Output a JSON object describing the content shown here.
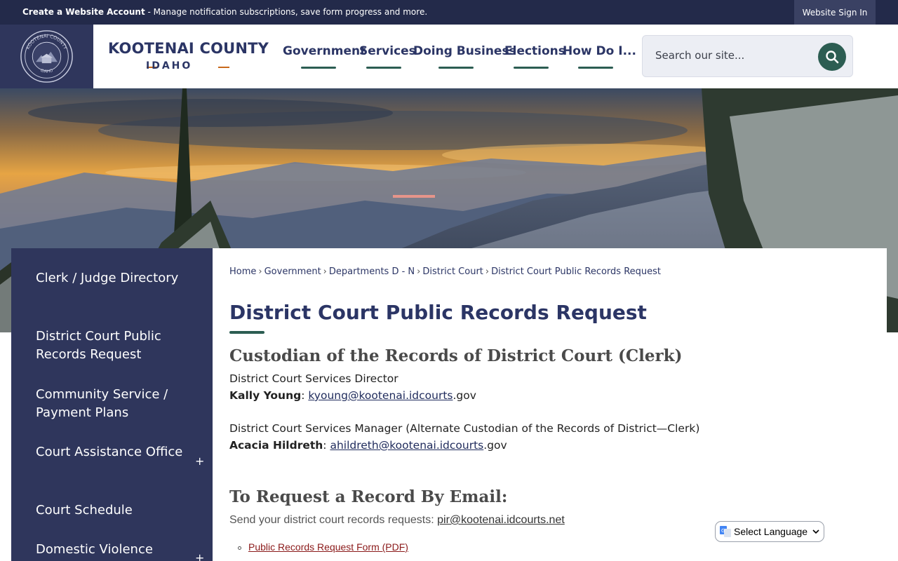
{
  "topbar": {
    "create_label": "Create a Website Account",
    "create_desc": " - Manage notification subscriptions, save form progress and more.",
    "signin_label": "Website Sign In"
  },
  "logo": {
    "title": "KOOTENAI COUNTY",
    "subtitle": "IDAHO",
    "seal_top_text": "KOOTENAI COUNTY",
    "seal_bottom_text": "IDAHO"
  },
  "nav": {
    "items": [
      {
        "label": "Government"
      },
      {
        "label": "Services"
      },
      {
        "label": "Doing Business"
      },
      {
        "label": "Elections"
      },
      {
        "label": "How Do I..."
      }
    ]
  },
  "search": {
    "placeholder": "Search our site..."
  },
  "sidebar": {
    "items": [
      {
        "label": "Clerk / Judge Directory",
        "expandable": false
      },
      {
        "label": "District Court Public Records Request",
        "expandable": false
      },
      {
        "label": "Community Service / Payment Plans",
        "expandable": false
      },
      {
        "label": "Court Assistance Office",
        "expandable": true
      },
      {
        "label": "Court Schedule",
        "expandable": false
      },
      {
        "label": "Domestic Violence",
        "expandable": true
      }
    ],
    "expand_symbol": "+"
  },
  "breadcrumb": {
    "items": [
      "Home",
      "Government",
      "Departments D - N",
      "District Court",
      "District Court Public Records Request"
    ],
    "separator": "›"
  },
  "main": {
    "title": "District Court Public Records Request",
    "custodian_heading": "Custodian of the Records of District Court (Clerk)",
    "director_role": "District Court Services Director",
    "director_name": "Kally Young",
    "director_email_link": "kyoung@kootenai.idcourts",
    "director_email_suffix": ".gov",
    "manager_role": "District Court Services Manager (Alternate Custodian of the Records of District—Clerk)",
    "manager_name": "Acacia Hildreth",
    "manager_email_link": "ahildreth@kootenai.idcourts",
    "manager_email_suffix": ".gov",
    "email_heading": "To Request a Record By Email:",
    "email_intro": "Send your district court records requests: ",
    "email_address": "pir@kootenai.idcourts.net",
    "pdf_link": "Public Records Request Form (PDF)"
  },
  "language": {
    "label": "Select Language"
  },
  "colors": {
    "navy": "#2f365c",
    "topbar": "#232a4a",
    "accent_green": "#2c5d52",
    "accent_orange": "#c8691b",
    "link_red": "#8b1a1a"
  }
}
